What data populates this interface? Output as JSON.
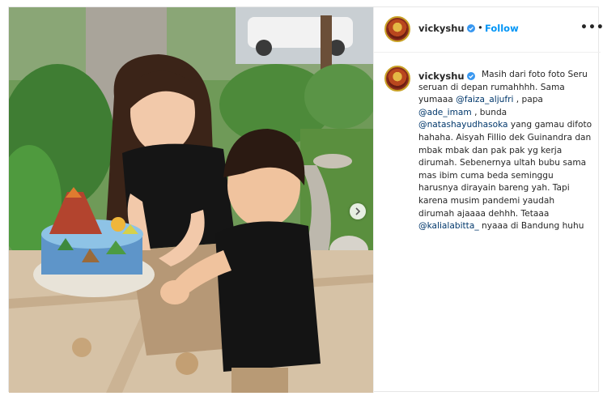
{
  "post": {
    "username": "vickyshu",
    "verified_icon": "verified-badge-icon",
    "separator": "•",
    "follow_label": "Follow",
    "more_label": "•••",
    "photo_alt": "Woman holding a dinosaur birthday cake with a toddler",
    "next_icon": "chevron-right-icon"
  },
  "caption": {
    "username": "vickyshu",
    "segments": [
      {
        "text": "Masih dari foto foto Seru seruan di depan rumahhhh. Sama yumaaa ",
        "mention": false
      },
      {
        "text": "@faiza_aljufri",
        "mention": true
      },
      {
        "text": " , papa ",
        "mention": false
      },
      {
        "text": "@ade_imam",
        "mention": true
      },
      {
        "text": " , bunda ",
        "mention": false
      },
      {
        "text": "@natashayudhasoka",
        "mention": true
      },
      {
        "text": " yang gamau difoto hahaha. Aisyah Fillio dek Guinandra dan mbak mbak dan pak pak yg kerja dirumah. Sebenernya ultah bubu sama mas ibim cuma beda seminggu harusnya dirayain bareng yah. Tapi karena musim pandemi yaudah dirumah ajaaaa dehhh. Tetaaa ",
        "mention": false
      },
      {
        "text": "@kalialabitta_",
        "mention": true
      },
      {
        "text": " nyaaa di Bandung huhu",
        "mention": false
      }
    ]
  },
  "colors": {
    "accent": "#0095f6",
    "mention": "#00376b",
    "text": "#262626",
    "border": "#efefef"
  }
}
